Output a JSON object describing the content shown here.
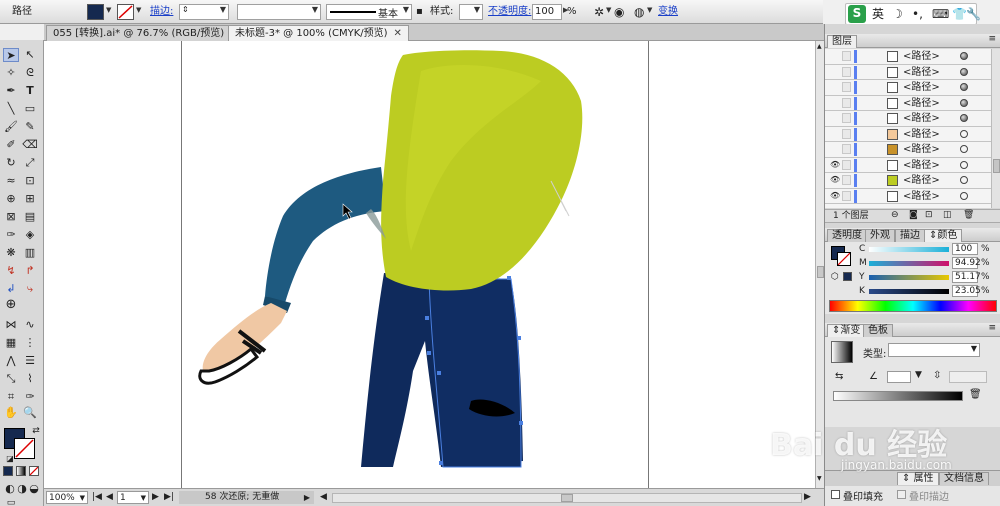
{
  "control_bar": {
    "selection_label": "路径",
    "stroke_label": "描边:",
    "profile_label": "基本",
    "style_label": "样式:",
    "opacity_label": "不透明度:",
    "opacity_value": "100",
    "opacity_unit": "%",
    "transform_label": "变换"
  },
  "ime": {
    "logo": "S",
    "mode": "英"
  },
  "document": {
    "tabs": [
      {
        "label": "055 [转换].ai* @ 76.7% (RGB/预览)"
      },
      {
        "label": "未标题-3* @ 100% (CMYK/预览)"
      }
    ],
    "active_tab": 1
  },
  "status_bar": {
    "zoom": "100%",
    "artboard_number": "1",
    "history_text": "58 次还原; 无重做"
  },
  "layers_panel": {
    "title": "图层",
    "rows": [
      {
        "name": "<路径>",
        "visible": false,
        "target_filled": true,
        "thumb_color": "#ffffff"
      },
      {
        "name": "<路径>",
        "visible": false,
        "target_filled": true,
        "thumb_color": "#ffffff"
      },
      {
        "name": "<路径>",
        "visible": false,
        "target_filled": true,
        "thumb_color": "#ffffff"
      },
      {
        "name": "<路径>",
        "visible": false,
        "target_filled": true,
        "thumb_color": "#ffffff"
      },
      {
        "name": "<路径>",
        "visible": false,
        "target_filled": true,
        "thumb_color": "#ffffff"
      },
      {
        "name": "<路径>",
        "visible": false,
        "target_filled": false,
        "thumb_color": "#f3c89a"
      },
      {
        "name": "<路径>",
        "visible": false,
        "target_filled": false,
        "thumb_color": "#c8922a"
      },
      {
        "name": "<路径>",
        "visible": true,
        "target_filled": false,
        "thumb_color": "#ffffff"
      },
      {
        "name": "<路径>",
        "visible": true,
        "target_filled": false,
        "thumb_color": "#bccc22"
      },
      {
        "name": "<路径>",
        "visible": true,
        "target_filled": false,
        "thumb_color": "#ffffff"
      }
    ],
    "footer": "1 个图层"
  },
  "color_panel": {
    "tabs": [
      "透明度",
      "外观",
      "描边",
      "颜色"
    ],
    "active_tab": 3,
    "channels": [
      {
        "name": "C",
        "value": "100",
        "color": "#1ab0d8"
      },
      {
        "name": "M",
        "value": "94.92",
        "color": "#d0106a"
      },
      {
        "name": "Y",
        "value": "51.17",
        "color": "#e8c800"
      },
      {
        "name": "K",
        "value": "23.05",
        "color": "#222222"
      }
    ],
    "unit": "%",
    "fill_color": "#15294f"
  },
  "gradient_panel": {
    "tabs": [
      "渐变",
      "色板"
    ],
    "active_tab": 0,
    "type_label": "类型:"
  },
  "bottom_panel": {
    "overprint_fill": "叠印填充",
    "overprint_stroke": "叠印描边"
  },
  "watermark": {
    "brand": "Bai du 经验",
    "url": "jingyan.baidu.com"
  },
  "colors": {
    "fill_swatch": "#15294f",
    "shirt": "#bccc22",
    "jeans": "#0f2a5c",
    "sleeve": "#1e5a80",
    "skin": "#f0c8a4"
  }
}
